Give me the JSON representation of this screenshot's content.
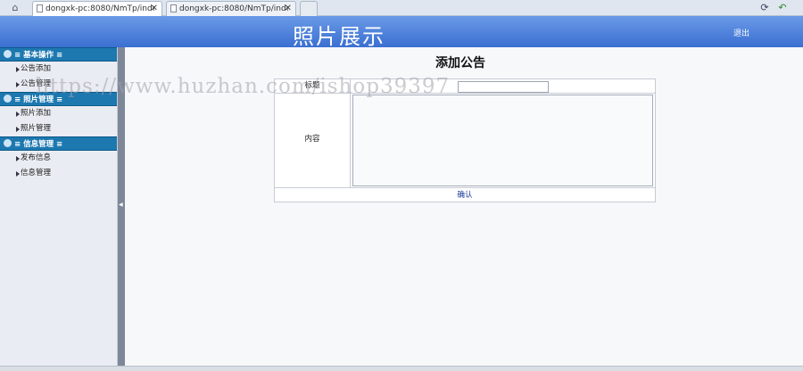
{
  "browser": {
    "tabs": [
      {
        "label": "dongxk-pc:8080/NmTp/inde",
        "active": true
      },
      {
        "label": "dongxk-pc:8080/NmTp/inde",
        "active": false
      }
    ],
    "close_glyph": "✕"
  },
  "header": {
    "title": "照片展示",
    "logout_label": "退出"
  },
  "sidebar": {
    "groups": [
      {
        "title": "≡ 基本操作 ≡",
        "items": [
          "公告添加",
          "公告管理"
        ]
      },
      {
        "title": "≡ 照片管理 ≡",
        "items": [
          "照片添加",
          "照片管理"
        ]
      },
      {
        "title": "≡ 信息管理 ≡",
        "items": [
          "发布信息",
          "信息管理"
        ]
      }
    ]
  },
  "form": {
    "heading": "添加公告",
    "title_label": "标题",
    "title_value": "",
    "content_label": "内容",
    "content_value": "",
    "submit_label": "确认"
  },
  "watermark": "https://www.huzhan.com/ishop39397",
  "colors": {
    "header": "#3b6fd2",
    "sidebar_group": "#1d78b0",
    "splitter": "#7e8898"
  },
  "icons": {
    "home": "home-icon",
    "refresh": "refresh-icon",
    "back": "back-arrow-icon"
  }
}
